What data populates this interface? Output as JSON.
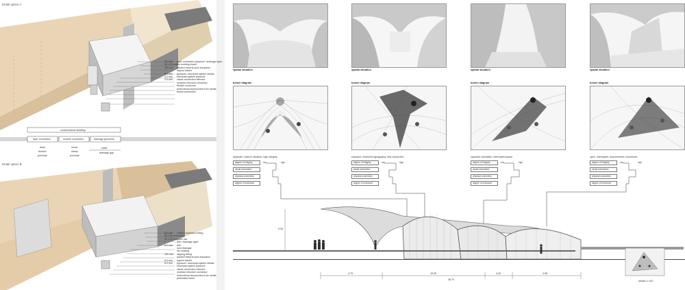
{
  "left_panel": {
    "detail_a_title": "Detail option A",
    "detail_b_title": "Detail option B",
    "detail_a_spec_values": [
      "8.0 mm",
      "50 x 50 mm",
      "100 mm",
      "",
      "8.0 mm",
      "3.0 mm",
      "3.0 mm"
    ],
    "detail_a_spec_labels": [
      "layer connection plywood / drainage layer",
      "fire molding board",
      "packed mineral wool insulation",
      "vapour barrier",
      "plywood / structural system details",
      "structural system plywood",
      "visual connection element",
      "modular structure connector",
      "flexible connector",
      "horticultural accessories from media",
      "dowel connection"
    ],
    "detail_b_spec_values": [
      "8.0 mm",
      "50 x 50 mm",
      "20 x 20 mm",
      "",
      "8.0 mm",
      "",
      "",
      "100 mm",
      "",
      "8.0 mm",
      "8.0 mm"
    ],
    "detail_b_spec_labels": [
      "outdoor plywood roofing",
      "column",
      "gutter bar",
      "lath / drainage layer",
      "lath",
      "oval drainage",
      "tile molding",
      "clipping fitting",
      "packed mineral wool insulation",
      "vapour barrier",
      "plywood / structural system details",
      "structural system plywood",
      "visual connection element",
      "modular structure connector",
      "horticultural accessories from media",
      "perforated sheet"
    ],
    "detailing_header": "constructional detailing",
    "detailing_tabs": [
      "layer connection",
      "module connection",
      "drainage geometry"
    ],
    "matrix_col1": [
      "draw",
      "tension",
      "punctual"
    ],
    "matrix_col2": [
      "screw",
      "clamp",
      "punctual"
    ],
    "matrix_col3": [
      "cable",
      "drainage gap"
    ]
  },
  "right_panel": {
    "columns": [
      {
        "spatial_label": "spatial situation",
        "tunnel_label": "tunnel diagram",
        "description": "separate / branch situation, high integrity",
        "rows": [
          "degree of integrity",
          "visual connection",
          "physical connection",
          "degree of enclosure"
        ]
      },
      {
        "spatial_label": "spatial situation",
        "tunnel_label": "tunnel diagram",
        "description": "exposed / branched typography, less connected",
        "rows": [
          "degree of integrity",
          "visual connection",
          "physical connection",
          "degree of enclosure"
        ]
      },
      {
        "spatial_label": "spatial situation",
        "tunnel_label": "tunnel diagram",
        "description": "upwards orientation, interrupted space",
        "rows": [
          "degree of integrity",
          "visual connection",
          "physical connection",
          "degree of enclosure"
        ]
      },
      {
        "spatial_label": "spatial situation",
        "tunnel_label": "tunnel diagram",
        "description": "open, interrupted, disconnected, movement",
        "rows": [
          "degree of integrity",
          "visual connection",
          "physical connection",
          "degree of enclosure"
        ]
      }
    ],
    "low_label": "low",
    "high_label": "high",
    "section_label": "section 1:100",
    "dimensions": [
      "4.75",
      "15.35",
      "4.20",
      "4.95"
    ],
    "total_dimension": "38.70",
    "height_dimension": "9.45",
    "accent_color": "#d9c3a0",
    "wood_color": "#e8d6b8"
  }
}
